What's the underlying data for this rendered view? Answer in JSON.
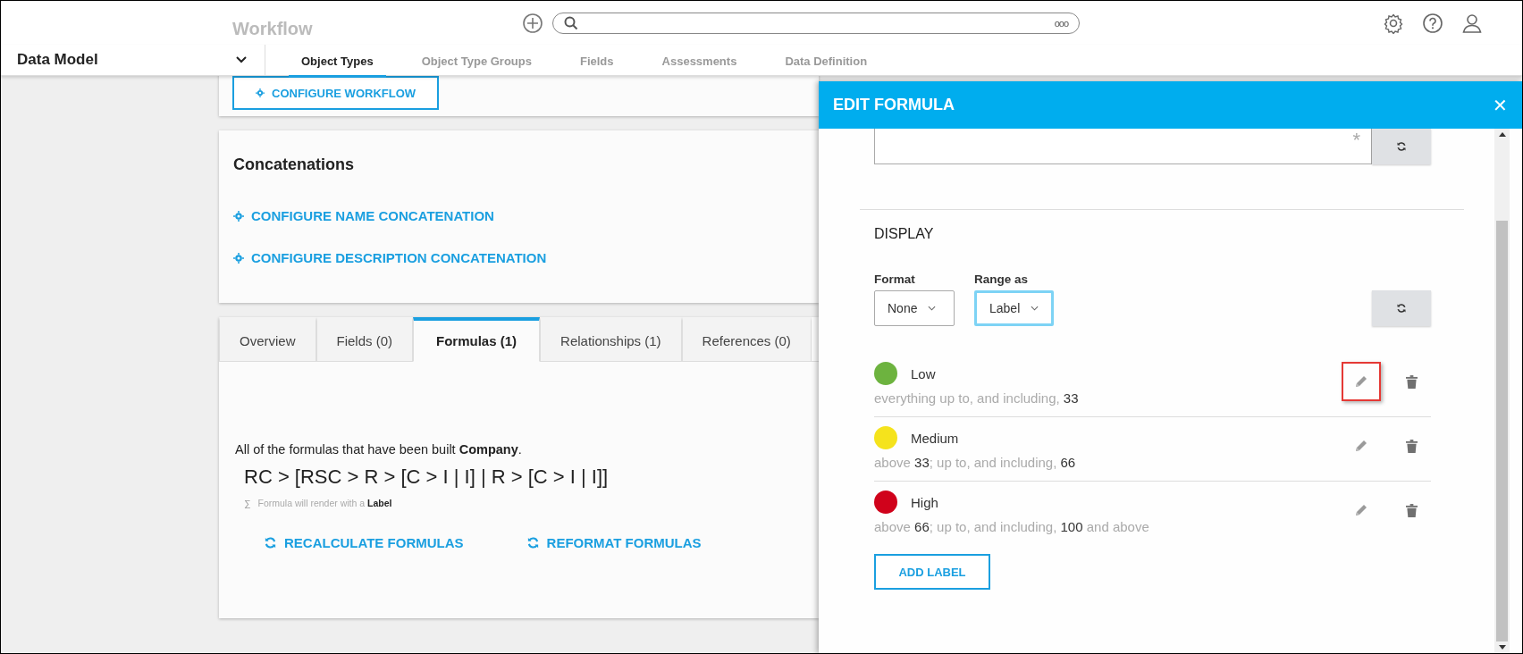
{
  "header": {
    "behind_title": "Workflow",
    "search": {
      "more": "ooo"
    }
  },
  "nav": {
    "title": "Data Model",
    "tabs": [
      {
        "label": "Object Types",
        "selected": true
      },
      {
        "label": "Object Type Groups",
        "selected": false
      },
      {
        "label": "Fields",
        "selected": false
      },
      {
        "label": "Assessments",
        "selected": false
      },
      {
        "label": "Data Definition",
        "selected": false
      }
    ]
  },
  "workflow_card": {
    "button": "CONFIGURE WORKFLOW"
  },
  "concatenations": {
    "title": "Concatenations",
    "links": [
      "CONFIGURE NAME CONCATENATION",
      "CONFIGURE DESCRIPTION CONCATENATION"
    ]
  },
  "detail_tabs": [
    {
      "label": "Overview",
      "selected": false
    },
    {
      "label": "Fields (0)",
      "selected": false
    },
    {
      "label": "Formulas (1)",
      "selected": true
    },
    {
      "label": "Relationships (1)",
      "selected": false
    },
    {
      "label": "References (0)",
      "selected": false
    }
  ],
  "formulas": {
    "intro": "All of the formulas that have been built **Company**.",
    "formula": "RC > [RSC > R > [C > I | I] | R > [C > I | I]]",
    "hint_symbol": "∑",
    "hint": "Formula will render with a **Label**",
    "actions": [
      "RECALCULATE FORMULAS",
      "REFORMAT FORMULAS"
    ]
  },
  "panel": {
    "title": "EDIT FORMULA",
    "close": "✕",
    "required_mark": "*",
    "section": "DISPLAY",
    "format": {
      "label": "Format",
      "value": "None",
      "focused": false
    },
    "range": {
      "label": "Range as",
      "value": "Label",
      "focused": true
    },
    "labels": [
      {
        "name": "Low",
        "color": "#6db33f",
        "description": "everything up to, and including, **33**",
        "highlighted": true
      },
      {
        "name": "Medium",
        "color": "#f5e31c",
        "description": "above **33**; up to, and including, **66**",
        "highlighted": false
      },
      {
        "name": "High",
        "color": "#d0021b",
        "description": "above **66**; up to, and including, **100** and above",
        "highlighted": false
      }
    ],
    "add_button": "ADD LABEL"
  }
}
